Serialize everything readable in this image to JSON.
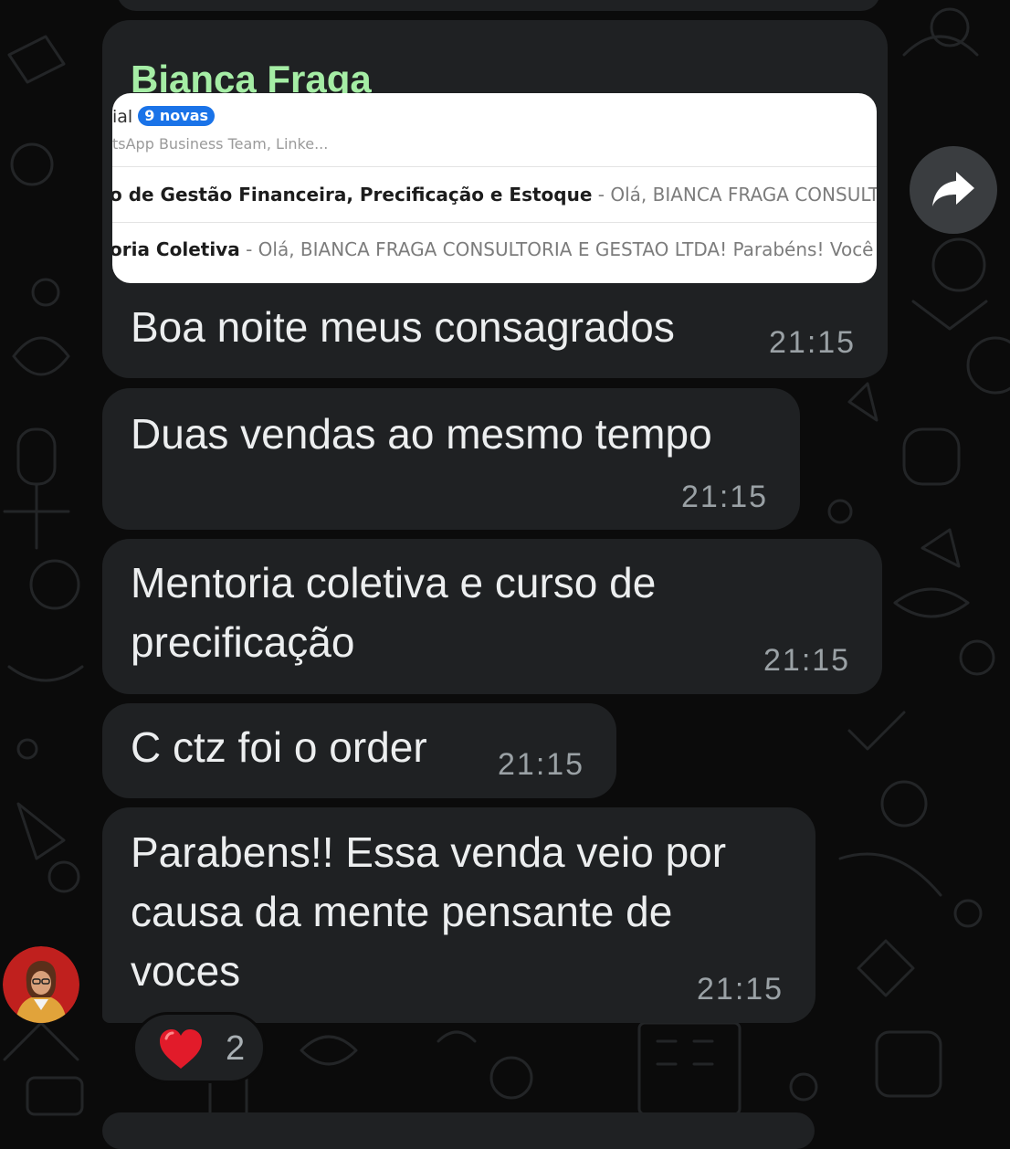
{
  "chat": {
    "sender_name": "Bianca Fraga",
    "sender_name_color": "#a5eda5",
    "bubble_color": "#1f2123",
    "background_color": "#0b0b0b",
    "preview": {
      "row1_title": "ial",
      "row1_badge": "9 novas",
      "row1_sub": "tsApp Business Team, Linke...",
      "row2_bold": "o de Gestão Financeira, Precificação e Estoque",
      "row2_rest": " - Olá, BIANCA FRAGA CONSULTORIA",
      "row3_bold": "oria Coletiva",
      "row3_rest": " - Olá, BIANCA FRAGA CONSULTORIA E GESTAO LTDA! Parabéns! Você ad"
    },
    "messages": [
      {
        "text": "Boa noite meus consagrados",
        "time": "21:15"
      },
      {
        "text": "Duas vendas ao mesmo tempo",
        "time": "21:15"
      },
      {
        "line1": "Mentoria coletiva e curso de",
        "line2": "precificação",
        "time": "21:15"
      },
      {
        "text": "C ctz foi o order",
        "time": "21:15"
      },
      {
        "line1": "Parabens!! Essa venda veio por",
        "line2": "causa da mente pensante de",
        "line3": "voces",
        "time": "21:15"
      }
    ],
    "reaction": {
      "emoji": "heart",
      "count": "2"
    },
    "icons": {
      "forward": "forward-arrow-icon",
      "avatar": "user-avatar",
      "reaction": "red-heart-icon"
    }
  }
}
